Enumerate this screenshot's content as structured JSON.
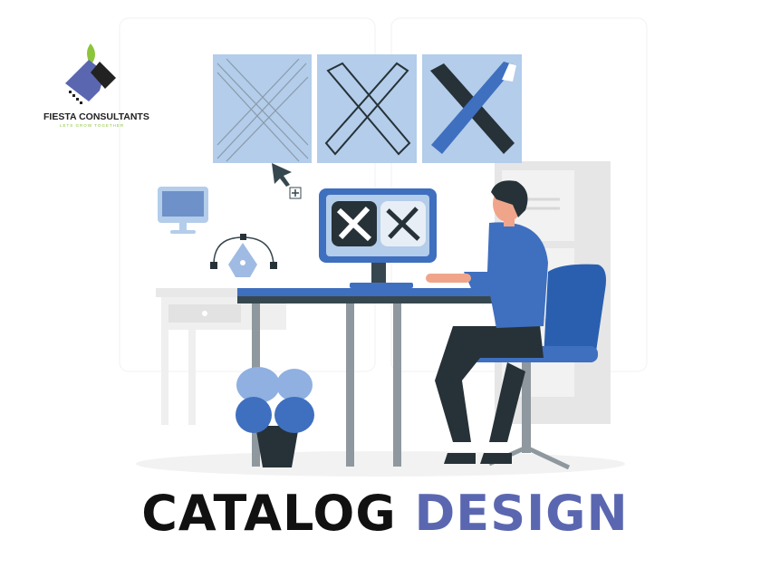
{
  "logo": {
    "name": "FIESTA CONSULTANTS",
    "tagline": "LETS GROW TOGETHER"
  },
  "headline": {
    "word1": "CATALOG",
    "word2": "DESIGN"
  },
  "colors": {
    "accent_blue": "#3f6fbf",
    "light_blue": "#b3cdea",
    "headline_dark": "#111111",
    "headline_accent": "#5a67b0",
    "logo_green": "#8cc43c"
  }
}
